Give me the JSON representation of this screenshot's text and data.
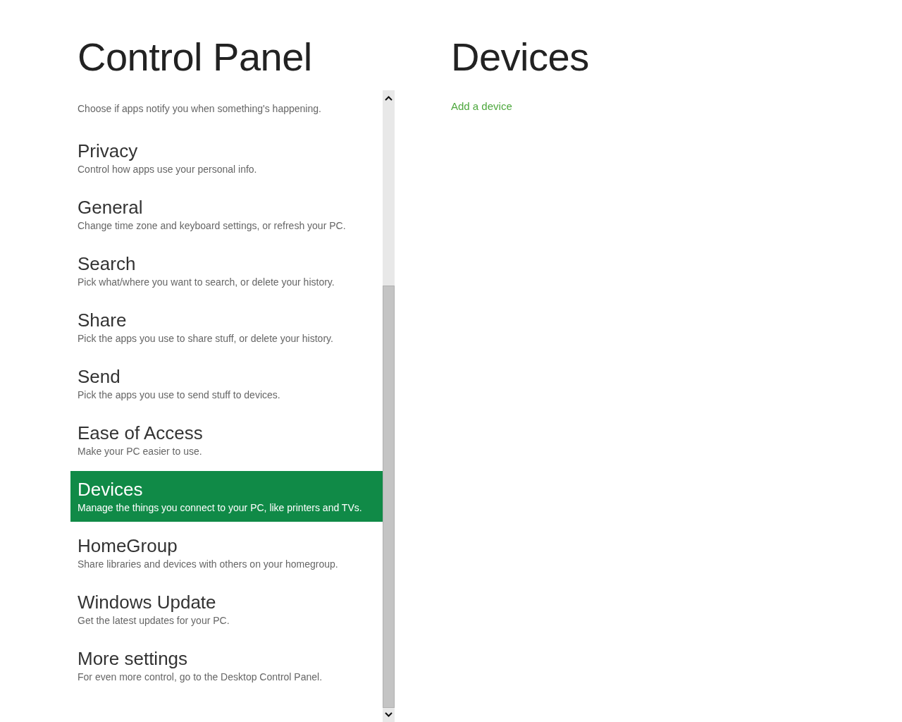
{
  "left_title": "Control Panel",
  "items": [
    {
      "description": "Choose if apps notify you when something's happening.",
      "selected": false
    },
    {
      "title": "Privacy",
      "description": "Control how apps use your personal info.",
      "selected": false
    },
    {
      "title": "General",
      "description": "Change time zone and keyboard settings, or refresh your PC.",
      "selected": false
    },
    {
      "title": "Search",
      "description": "Pick what/where you want to search, or delete your history.",
      "selected": false
    },
    {
      "title": "Share",
      "description": "Pick the apps you use to share stuff, or delete your history.",
      "selected": false
    },
    {
      "title": "Send",
      "description": "Pick the apps you use to send stuff to devices.",
      "selected": false
    },
    {
      "title": "Ease of Access",
      "description": "Make your PC easier to use.",
      "selected": false
    },
    {
      "title": "Devices",
      "description": "Manage the things you connect to your PC, like printers and TVs.",
      "selected": true
    },
    {
      "title": "HomeGroup",
      "description": "Share libraries and devices with others on your homegroup.",
      "selected": false
    },
    {
      "title": "Windows Update",
      "description": "Get the latest updates for your PC.",
      "selected": false
    },
    {
      "title": "More settings",
      "description": "For even more control, go to the Desktop Control Panel.",
      "selected": false
    }
  ],
  "right_title": "Devices",
  "link": "Add a device"
}
